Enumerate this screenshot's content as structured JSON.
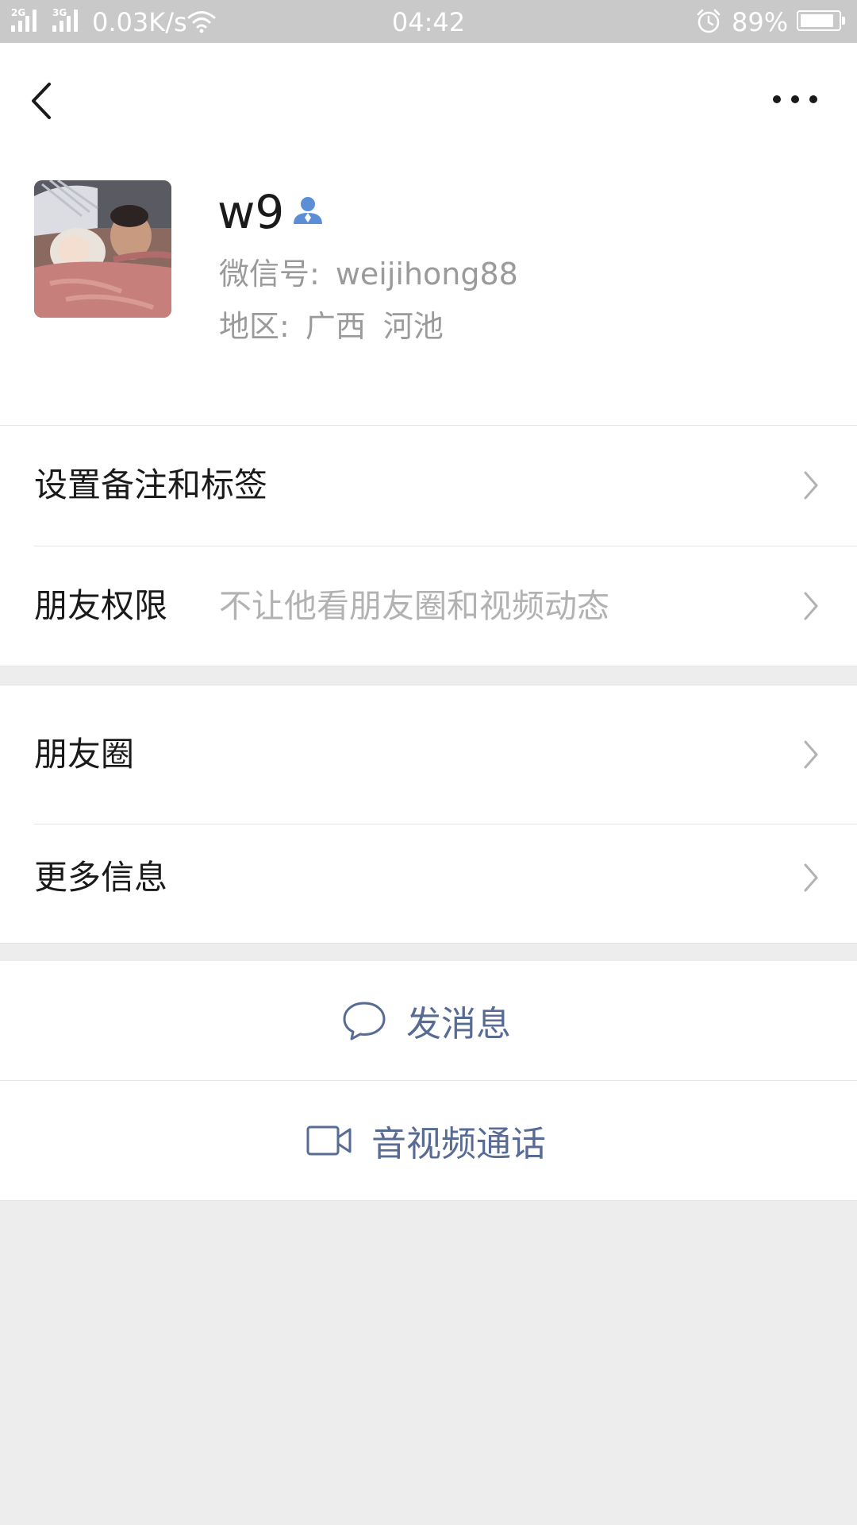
{
  "status_bar": {
    "network_1": "2G",
    "network_2": "3G",
    "speed": "0.03K/s",
    "time": "04:42",
    "battery_percent": "89%",
    "battery_level": 0.89,
    "icons": [
      "signal-icon",
      "wifi-icon",
      "alarm-icon",
      "battery-icon"
    ]
  },
  "header": {
    "back_icon": "chevron-left-icon",
    "more_icon": "more-dots-icon"
  },
  "profile": {
    "name": "w9",
    "wechat_id_label": "微信号:",
    "wechat_id": "weijihong88",
    "region_label": "地区:",
    "region_province": "广西",
    "region_city": "河池",
    "contact_icon": "contact-person-icon"
  },
  "settings_group": {
    "remark_label": "设置备注和标签",
    "permission_label": "朋友权限",
    "permission_value": "不让他看朋友圈和视频动态"
  },
  "info_group": {
    "moments_label": "朋友圈",
    "more_info_label": "更多信息"
  },
  "actions": {
    "message_label": "发消息",
    "message_icon": "chat-bubble-icon",
    "call_label": "音视频通话",
    "call_icon": "video-camera-icon"
  },
  "colors": {
    "link_blue": "#576b95",
    "background": "#ededed",
    "status_bar": "#c9c9c9",
    "contact_icon": "#5b8ed6"
  }
}
